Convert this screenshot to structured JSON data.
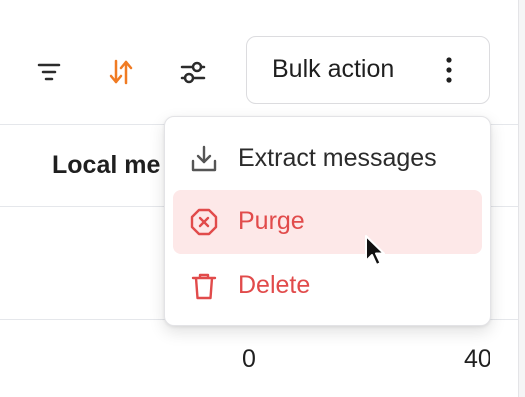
{
  "toolbar": {
    "icons": [
      "filter-icon",
      "sort-icon",
      "sliders-icon"
    ],
    "bulk_action_label": "Bulk action",
    "more_icon": "vertical-ellipsis-icon"
  },
  "colors": {
    "accent_orange": "#f07b23",
    "danger": "#e14b4b",
    "danger_bg": "#fde8e8",
    "text": "#1f1f1f",
    "border": "#dcdcdf"
  },
  "table": {
    "header": "Local me",
    "row_values": [
      "0",
      "40"
    ]
  },
  "menu": {
    "items": [
      {
        "label": "Extract messages",
        "icon": "download-icon",
        "tone": "neutral"
      },
      {
        "label": "Purge",
        "icon": "x-octagon-icon",
        "tone": "danger",
        "hovered": true
      },
      {
        "label": "Delete",
        "icon": "trash-icon",
        "tone": "danger"
      }
    ]
  }
}
